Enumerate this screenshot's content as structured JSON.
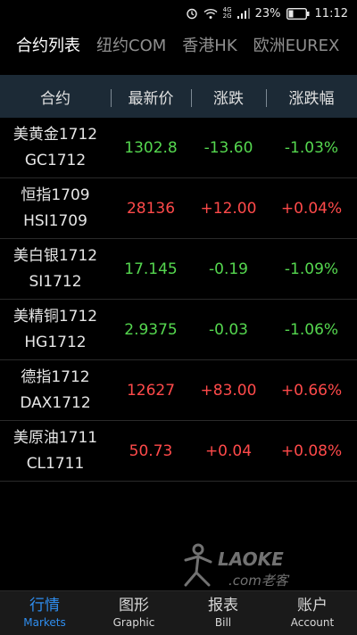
{
  "status": {
    "battery": "23%",
    "time": "11:12",
    "network": "4G 2G"
  },
  "tabs": [
    {
      "label": "合约列表",
      "active": true
    },
    {
      "label": "纽约COM",
      "active": false
    },
    {
      "label": "香港HK",
      "active": false
    },
    {
      "label": "欧洲EUREX",
      "active": false
    }
  ],
  "headers": {
    "contract": "合约",
    "price": "最新价",
    "change": "涨跌",
    "change_pct": "涨跌幅"
  },
  "rows": [
    {
      "name": "美黄金1712",
      "code": "GC1712",
      "price": "1302.8",
      "change": "-13.60",
      "pct": "-1.03%",
      "direction": "down"
    },
    {
      "name": "恒指1709",
      "code": "HSI1709",
      "price": "28136",
      "change": "+12.00",
      "pct": "+0.04%",
      "direction": "up"
    },
    {
      "name": "美白银1712",
      "code": "SI1712",
      "price": "17.145",
      "change": "-0.19",
      "pct": "-1.09%",
      "direction": "down"
    },
    {
      "name": "美精铜1712",
      "code": "HG1712",
      "price": "2.9375",
      "change": "-0.03",
      "pct": "-1.06%",
      "direction": "down"
    },
    {
      "name": "德指1712",
      "code": "DAX1712",
      "price": "12627",
      "change": "+83.00",
      "pct": "+0.66%",
      "direction": "up"
    },
    {
      "name": "美原油1711",
      "code": "CL1711",
      "price": "50.73",
      "change": "+0.04",
      "pct": "+0.08%",
      "direction": "up"
    }
  ],
  "watermark": {
    "text": "LAOKE.com老客"
  },
  "nav": [
    {
      "zh": "行情",
      "en": "Markets",
      "active": true
    },
    {
      "zh": "图形",
      "en": "Graphic",
      "active": false
    },
    {
      "zh": "报表",
      "en": "Bill",
      "active": false
    },
    {
      "zh": "账户",
      "en": "Account",
      "active": false
    }
  ],
  "colors": {
    "up": "#ff4a4a",
    "down": "#55d74f",
    "accent": "#2f8ef0",
    "header_bg": "#1c2a36"
  },
  "icons": [
    "alarm-icon",
    "wifi-icon",
    "signal-icon",
    "battery-icon"
  ]
}
